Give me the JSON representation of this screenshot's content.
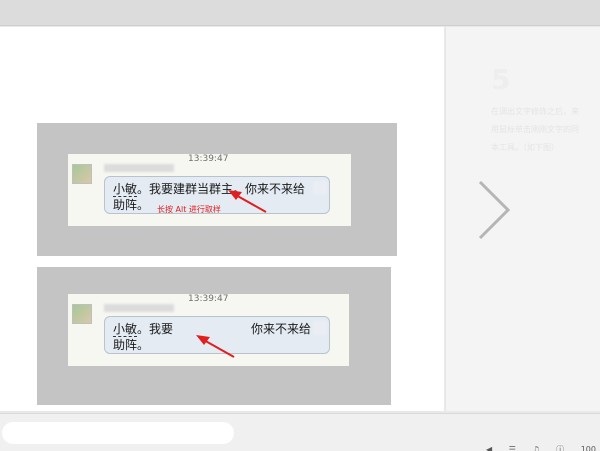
{
  "slide": {
    "panel1": {
      "timestamp": "13:39:47",
      "message_name": "小敏",
      "message_line1_rest": "。我要建群当群主。你来不来给",
      "message_line2": "助阵。",
      "hint": "长按 Alt 进行取样"
    },
    "panel2": {
      "timestamp": "13:39:47",
      "message_name": "小敏",
      "message_line1_part1": "。我要",
      "message_line1_part2": "你来不来给",
      "message_line2": "助阵。"
    }
  },
  "side_panel": {
    "step_number": "5",
    "step_text": "在调出文字修饰之后，来\n用鼠标单击刚刚文字的同\n本工具。（如下图）"
  },
  "icons": {
    "next": "chevron-right-icon",
    "arrow": "red-arrow-icon"
  },
  "colors": {
    "annotation_red": "#e02020",
    "bubble": "#e4ebf3"
  },
  "taskbar": {
    "zoom": "100"
  }
}
